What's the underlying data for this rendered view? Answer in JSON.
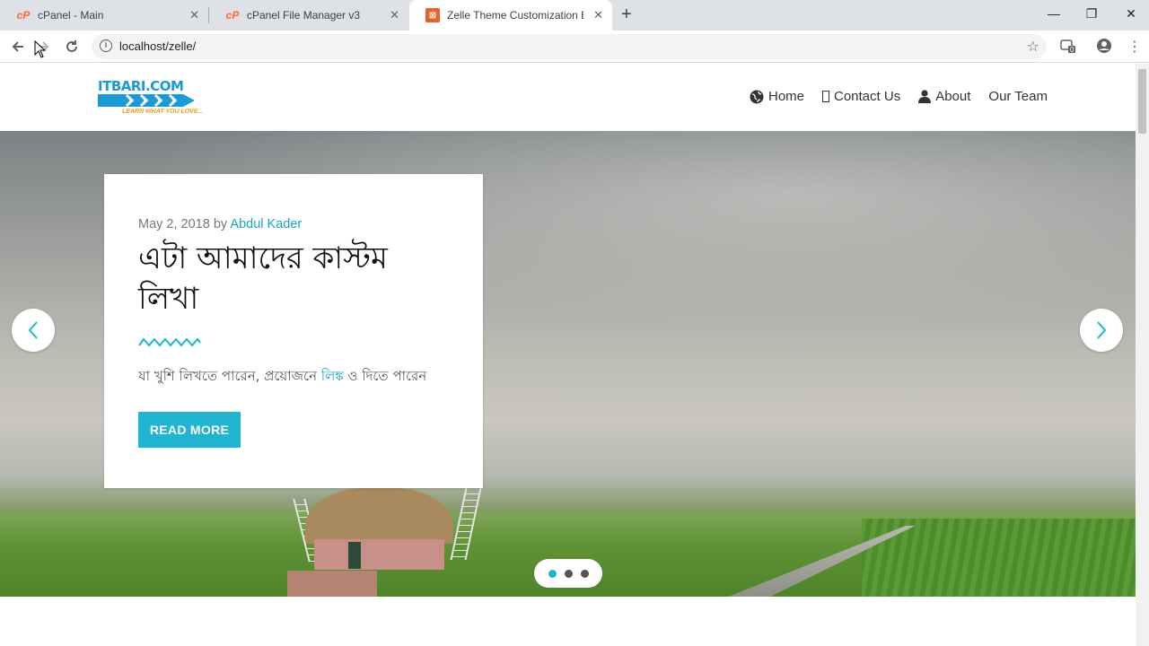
{
  "browser": {
    "tabs": [
      {
        "title": "cPanel - Main",
        "favicon": "cpanel-icon"
      },
      {
        "title": "cPanel File Manager v3",
        "favicon": "cpanel-icon"
      },
      {
        "title": "Zelle Theme Customization Edite",
        "favicon": "xampp-icon",
        "active": true
      }
    ],
    "new_tab": "+",
    "url": "localhost/zelle/",
    "extension_badge": "0"
  },
  "site": {
    "logo": {
      "brand": "ITBARI.COM",
      "tagline": "LEARN WHAT YOU LOVE..."
    },
    "nav": [
      {
        "label": "Home",
        "icon": "globe-icon"
      },
      {
        "label": "Contact Us",
        "icon": "missing-glyph-icon"
      },
      {
        "label": "About",
        "icon": "user-icon"
      },
      {
        "label": "Our Team",
        "icon": ""
      }
    ],
    "slide": {
      "date": "May 2, 2018",
      "by": "by",
      "author": "Abdul Kader",
      "title": "এটা আমাদের কাস্টম লিখা",
      "excerpt_before": "যা খুশি লিখতে পারেন, প্রয়োজনে ",
      "excerpt_link": "লিঙ্ক",
      "excerpt_after": " ও দিতে পারেন",
      "button": "READ MORE"
    },
    "slider": {
      "total_slides": 3,
      "active_slide": 1
    },
    "accent_color": "#1fb5d1"
  }
}
